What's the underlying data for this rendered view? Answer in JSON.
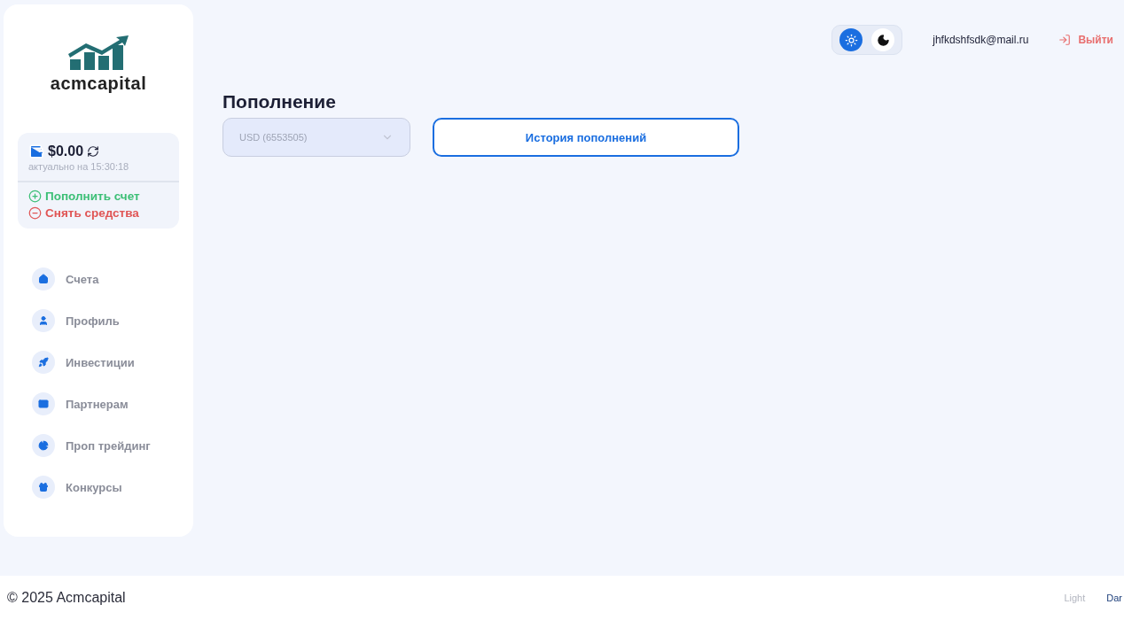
{
  "logo": {
    "text": "acmcapital"
  },
  "balance": {
    "amount": "$0.00",
    "updated": "актуально на 15:30:18"
  },
  "balance_actions": [
    {
      "kind": "deposit",
      "label": "Пополнить счет"
    },
    {
      "kind": "withdraw",
      "label": "Снять средства"
    }
  ],
  "nav": [
    {
      "label": "Счета"
    },
    {
      "label": "Профиль"
    },
    {
      "label": "Инвестиции"
    },
    {
      "label": "Партнерам"
    },
    {
      "label": "Проп трейдинг"
    },
    {
      "label": "Конкурсы"
    }
  ],
  "header": {
    "theme_toggle": [
      {
        "kind": "light",
        "selected": true
      },
      {
        "kind": "dark",
        "selected": false
      }
    ],
    "email": "jhfkdshfsdk@mail.ru",
    "logout": "Выйти"
  },
  "page": {
    "title": "Пополнение",
    "account_select": {
      "value": "USD (6553505)",
      "disabled": true
    },
    "history_button": "История пополнений"
  },
  "footer": {
    "copyright": "© 2025 Acmcapital",
    "themes": [
      {
        "label": "Light",
        "selected": false
      },
      {
        "label": "Dar",
        "selected": true
      }
    ]
  }
}
